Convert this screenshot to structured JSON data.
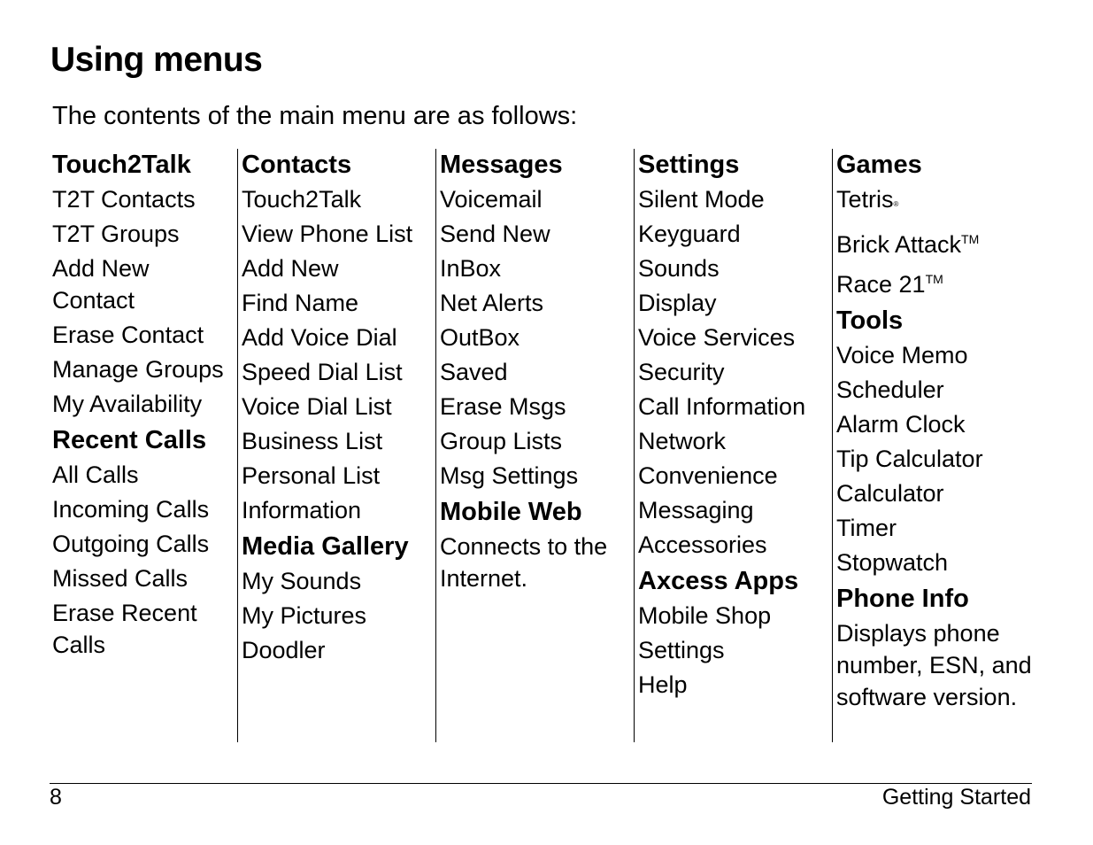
{
  "page": {
    "title": "Using menus",
    "intro": "The contents of the main menu are as follows:"
  },
  "columns": [
    {
      "blocks": [
        {
          "type": "heading",
          "text": "Touch2Talk"
        },
        {
          "type": "item",
          "text": "T2T Contacts"
        },
        {
          "type": "item",
          "text": "T2T Groups"
        },
        {
          "type": "item",
          "text": "Add New Contact"
        },
        {
          "type": "item",
          "text": "Erase Contact"
        },
        {
          "type": "item",
          "text": "Manage Groups"
        },
        {
          "type": "item",
          "text": "My Availability"
        },
        {
          "type": "heading",
          "text": "Recent Calls"
        },
        {
          "type": "item",
          "text": "All Calls"
        },
        {
          "type": "item",
          "text": "Incoming Calls"
        },
        {
          "type": "item",
          "text": "Outgoing Calls"
        },
        {
          "type": "item",
          "text": "Missed Calls"
        },
        {
          "type": "item",
          "text": "Erase Recent Calls"
        }
      ]
    },
    {
      "blocks": [
        {
          "type": "heading",
          "text": "Contacts"
        },
        {
          "type": "item",
          "text": "Touch2Talk"
        },
        {
          "type": "item",
          "text": "View Phone List"
        },
        {
          "type": "item",
          "text": "Add New"
        },
        {
          "type": "item",
          "text": "Find Name"
        },
        {
          "type": "item",
          "text": "Add Voice Dial"
        },
        {
          "type": "item",
          "text": "Speed Dial List"
        },
        {
          "type": "item",
          "text": "Voice Dial List"
        },
        {
          "type": "item",
          "text": "Business List"
        },
        {
          "type": "item",
          "text": "Personal List"
        },
        {
          "type": "item",
          "text": "Information"
        },
        {
          "type": "heading",
          "text": "Media Gallery"
        },
        {
          "type": "item",
          "text": "My Sounds"
        },
        {
          "type": "item",
          "text": "My Pictures"
        },
        {
          "type": "item",
          "text": "Doodler"
        }
      ]
    },
    {
      "blocks": [
        {
          "type": "heading",
          "text": "Messages"
        },
        {
          "type": "item",
          "text": "Voicemail"
        },
        {
          "type": "item",
          "text": "Send New"
        },
        {
          "type": "item",
          "text": "InBox"
        },
        {
          "type": "item",
          "text": "Net Alerts"
        },
        {
          "type": "item",
          "text": "OutBox"
        },
        {
          "type": "item",
          "text": "Saved"
        },
        {
          "type": "item",
          "text": "Erase Msgs"
        },
        {
          "type": "item",
          "text": "Group Lists"
        },
        {
          "type": "item",
          "text": "Msg Settings"
        },
        {
          "type": "heading",
          "text": "Mobile Web"
        },
        {
          "type": "item",
          "text": "Connects to the Internet."
        }
      ]
    },
    {
      "blocks": [
        {
          "type": "heading",
          "text": "Settings"
        },
        {
          "type": "item",
          "text": "Silent Mode"
        },
        {
          "type": "item",
          "text": "Keyguard"
        },
        {
          "type": "item",
          "text": "Sounds"
        },
        {
          "type": "item",
          "text": "Display"
        },
        {
          "type": "item",
          "text": "Voice Services"
        },
        {
          "type": "item",
          "text": "Security"
        },
        {
          "type": "item",
          "text": "Call Information"
        },
        {
          "type": "item",
          "text": "Network"
        },
        {
          "type": "item",
          "text": "Convenience"
        },
        {
          "type": "item",
          "text": "Messaging"
        },
        {
          "type": "item",
          "text": "Accessories"
        },
        {
          "type": "heading",
          "text": "Axcess Apps"
        },
        {
          "type": "item",
          "text": "Mobile Shop"
        },
        {
          "type": "item",
          "text": "Settings"
        },
        {
          "type": "item",
          "text": "Help"
        }
      ]
    },
    {
      "blocks": [
        {
          "type": "heading",
          "text": "Games"
        },
        {
          "type": "item",
          "text": "Tetris",
          "mark": "®"
        },
        {
          "type": "item",
          "text": "Brick Attack",
          "mark": "TM"
        },
        {
          "type": "item",
          "text": "Race 21",
          "mark": "TM"
        },
        {
          "type": "heading",
          "text": "Tools"
        },
        {
          "type": "item",
          "text": "Voice Memo"
        },
        {
          "type": "item",
          "text": "Scheduler"
        },
        {
          "type": "item",
          "text": "Alarm Clock"
        },
        {
          "type": "item",
          "text": "Tip Calculator"
        },
        {
          "type": "item",
          "text": "Calculator"
        },
        {
          "type": "item",
          "text": "Timer"
        },
        {
          "type": "item",
          "text": "Stopwatch"
        },
        {
          "type": "heading",
          "text": "Phone Info"
        },
        {
          "type": "item",
          "text": "Displays phone number, ESN, and software version."
        }
      ]
    }
  ],
  "footer": {
    "page_number": "8",
    "section": "Getting Started"
  }
}
